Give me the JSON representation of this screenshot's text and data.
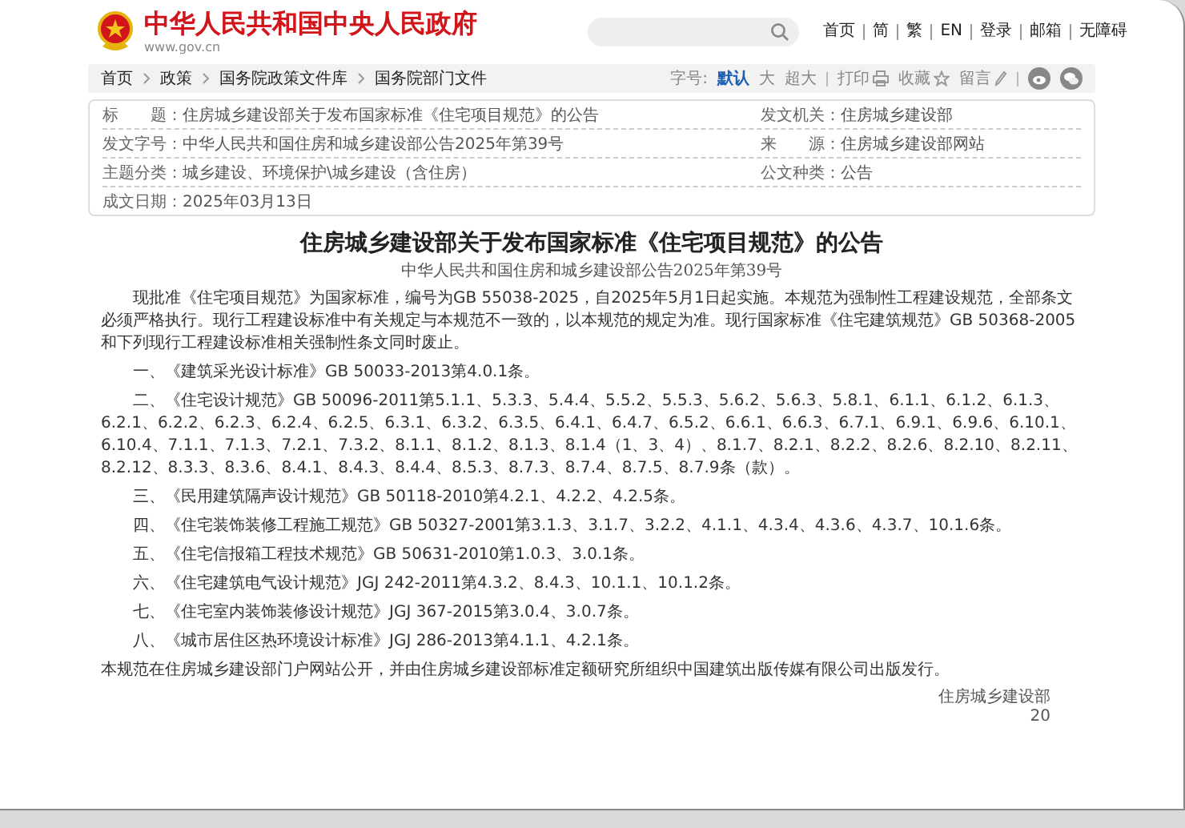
{
  "header": {
    "site_name": "中华人民共和国中央人民政府",
    "site_url": "www.gov.cn",
    "nav": [
      "首页",
      "简",
      "繁",
      "EN",
      "登录",
      "邮箱",
      "无障碍"
    ]
  },
  "breadcrumb": {
    "items": [
      "首页",
      "政策",
      "国务院政策文件库",
      "国务院部门文件"
    ],
    "font_size_label": "字号:",
    "font_sizes": [
      {
        "label": "默认",
        "selected": true
      },
      {
        "label": "大",
        "selected": false
      },
      {
        "label": "超大",
        "selected": false
      }
    ],
    "actions": [
      {
        "label": "打印",
        "kind": "print"
      },
      {
        "label": "收藏",
        "kind": "star"
      },
      {
        "label": "留言",
        "kind": "pencil"
      }
    ]
  },
  "meta": {
    "rows": [
      {
        "label": "标　　题：",
        "value": "住房城乡建设部关于发布国家标准《住宅项目规范》的公告",
        "label_2": "发文机关：",
        "value_2": "住房城乡建设部"
      },
      {
        "label": "发文字号：",
        "value": "中华人民共和国住房和城乡建设部公告2025年第39号",
        "label_2": "来　　源：",
        "value_2": "住房城乡建设部网站"
      },
      {
        "label": "主题分类：",
        "value": "城乡建设、环境保护\\城乡建设（含住房）",
        "label_2": "公文种类：",
        "value_2": "公告"
      },
      {
        "label": "成文日期：",
        "value": "2025年03月13日"
      }
    ]
  },
  "article": {
    "title": "住房城乡建设部关于发布国家标准《住宅项目规范》的公告",
    "subtitle": "中华人民共和国住房和城乡建设部公告2025年第39号",
    "paragraphs": [
      "现批准《住宅项目规范》为国家标准，编号为GB 55038-2025，自2025年5月1日起实施。本规范为强制性工程建设规范，全部条文必须严格执行。现行工程建设标准中有关规定与本规范不一致的，以本规范的规定为准。现行国家标准《住宅建筑规范》GB 50368-2005和下列现行工程建设标准相关强制性条文同时废止。",
      "一、《建筑采光设计标准》GB 50033-2013第4.0.1条。",
      "二、《住宅设计规范》GB 50096-2011第5.1.1、5.3.3、5.4.4、5.5.2、5.5.3、5.6.2、5.6.3、5.8.1、6.1.1、6.1.2、6.1.3、6.2.1、6.2.2、6.2.3、6.2.4、6.2.5、6.3.1、6.3.2、6.3.5、6.4.1、6.4.7、6.5.2、6.6.1、6.6.3、6.7.1、6.9.1、6.9.6、6.10.1、6.10.4、7.1.1、7.1.3、7.2.1、7.3.2、8.1.1、8.1.2、8.1.3、8.1.4（1、3、4）、8.1.7、8.2.1、8.2.2、8.2.6、8.2.10、8.2.11、8.2.12、8.3.3、8.3.6、8.4.1、8.4.3、8.4.4、8.5.3、8.7.3、8.7.4、8.7.5、8.7.9条（款）。",
      "三、《民用建筑隔声设计规范》GB 50118-2010第4.2.1、4.2.2、4.2.5条。",
      "四、《住宅装饰装修工程施工规范》GB 50327-2001第3.1.3、3.1.7、3.2.2、4.1.1、4.3.4、4.3.6、4.3.7、10.1.6条。",
      "五、《住宅信报箱工程技术规范》GB 50631-2010第1.0.3、3.0.1条。",
      "六、《住宅建筑电气设计规范》JGJ 242-2011第4.3.2、8.4.3、10.1.1、10.1.2条。",
      "七、《住宅室内装饰装修设计规范》JGJ 367-2015第3.0.4、3.0.7条。",
      "八、《城市居住区热环境设计标准》JGJ 286-2013第4.1.1、4.2.1条。",
      "本规范在住房城乡建设部门户网站公开，并由住房城乡建设部标准定额研究所组织中国建筑出版传媒有限公司出版发行。"
    ],
    "signature": "住房城乡建设部",
    "date": "20"
  }
}
